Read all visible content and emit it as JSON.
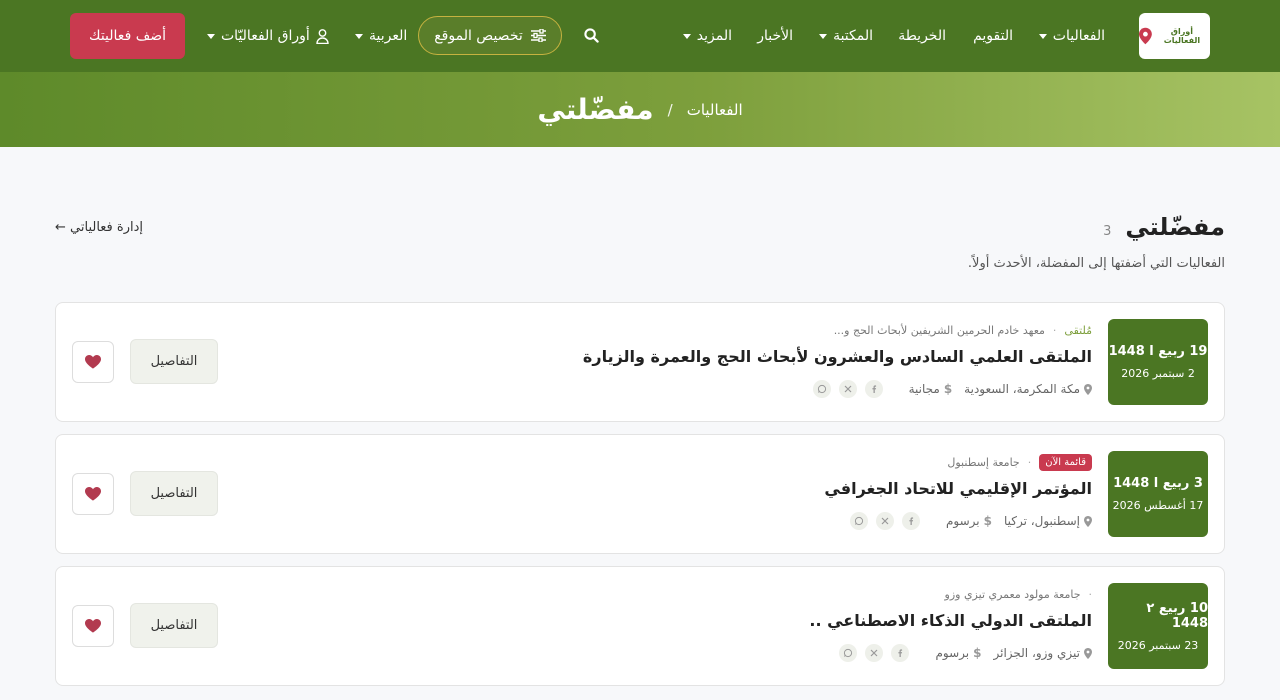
{
  "nav": {
    "logo_text": "أوراق الفعاليات",
    "items": [
      {
        "label": "الفعاليات",
        "caret": true
      },
      {
        "label": "التقويم",
        "caret": false
      },
      {
        "label": "الخريطة",
        "caret": false
      },
      {
        "label": "المكتبة",
        "caret": true
      },
      {
        "label": "الأخبار",
        "caret": false
      },
      {
        "label": "المزيد",
        "caret": true
      }
    ],
    "customize_label": "تخصيص الموقع",
    "language_label": "العربية",
    "account_label": "أوراق الفعاليّات",
    "add_event_label": "أضف فعاليتك",
    "colors": {
      "primary": "#4b7623",
      "accent": "#c93a4f"
    }
  },
  "hero": {
    "breadcrumb_parent": "الفعاليات",
    "separator": "/",
    "title": "مفضّلتي"
  },
  "header": {
    "title": "مفضّلتي",
    "count": "3",
    "subtitle": "الفعاليات التي أضفتها إلى المفضلة، الأحدث أولاً.",
    "manage_link": "إدارة فعالياتي ←"
  },
  "events": [
    {
      "hijri_date": "19 ربيع ا 1448",
      "greg_date": "2 سبتمبر 2026",
      "type": "مُلتقى",
      "badge": "",
      "organizer": "معهد خادم الحرمين الشريفين لأبحاث الحج و...",
      "title": "الملتقى العلمي السادس والعشرون لأبحاث الحج والعمرة والزيارة",
      "location": "مكة المكرمة، السعودية",
      "fee": "مجانية",
      "details_label": "التفاصيل"
    },
    {
      "hijri_date": "3 ربيع ا 1448",
      "greg_date": "17 أغسطس 2026",
      "type": "",
      "badge": "قائمة الآن",
      "organizer": "جامعة إسطنبول",
      "title": "المؤتمر الإقليمي للاتحاد الجغرافي",
      "location": "إسطنبول، تركيا",
      "fee": "برسوم",
      "details_label": "التفاصيل"
    },
    {
      "hijri_date": "10 ربيع ٢ 1448",
      "greg_date": "23 سبتمبر 2026",
      "type": "",
      "badge": "",
      "organizer": "جامعة مولود معمري تيزي وزو",
      "title": "الملتقى الدولي الذكاء الاصطناعي ..",
      "location": "تيزي وزو، الجزائر",
      "fee": "برسوم",
      "details_label": "التفاصيل"
    }
  ],
  "share_icons": [
    "facebook-icon",
    "x-icon",
    "whatsapp-icon"
  ]
}
